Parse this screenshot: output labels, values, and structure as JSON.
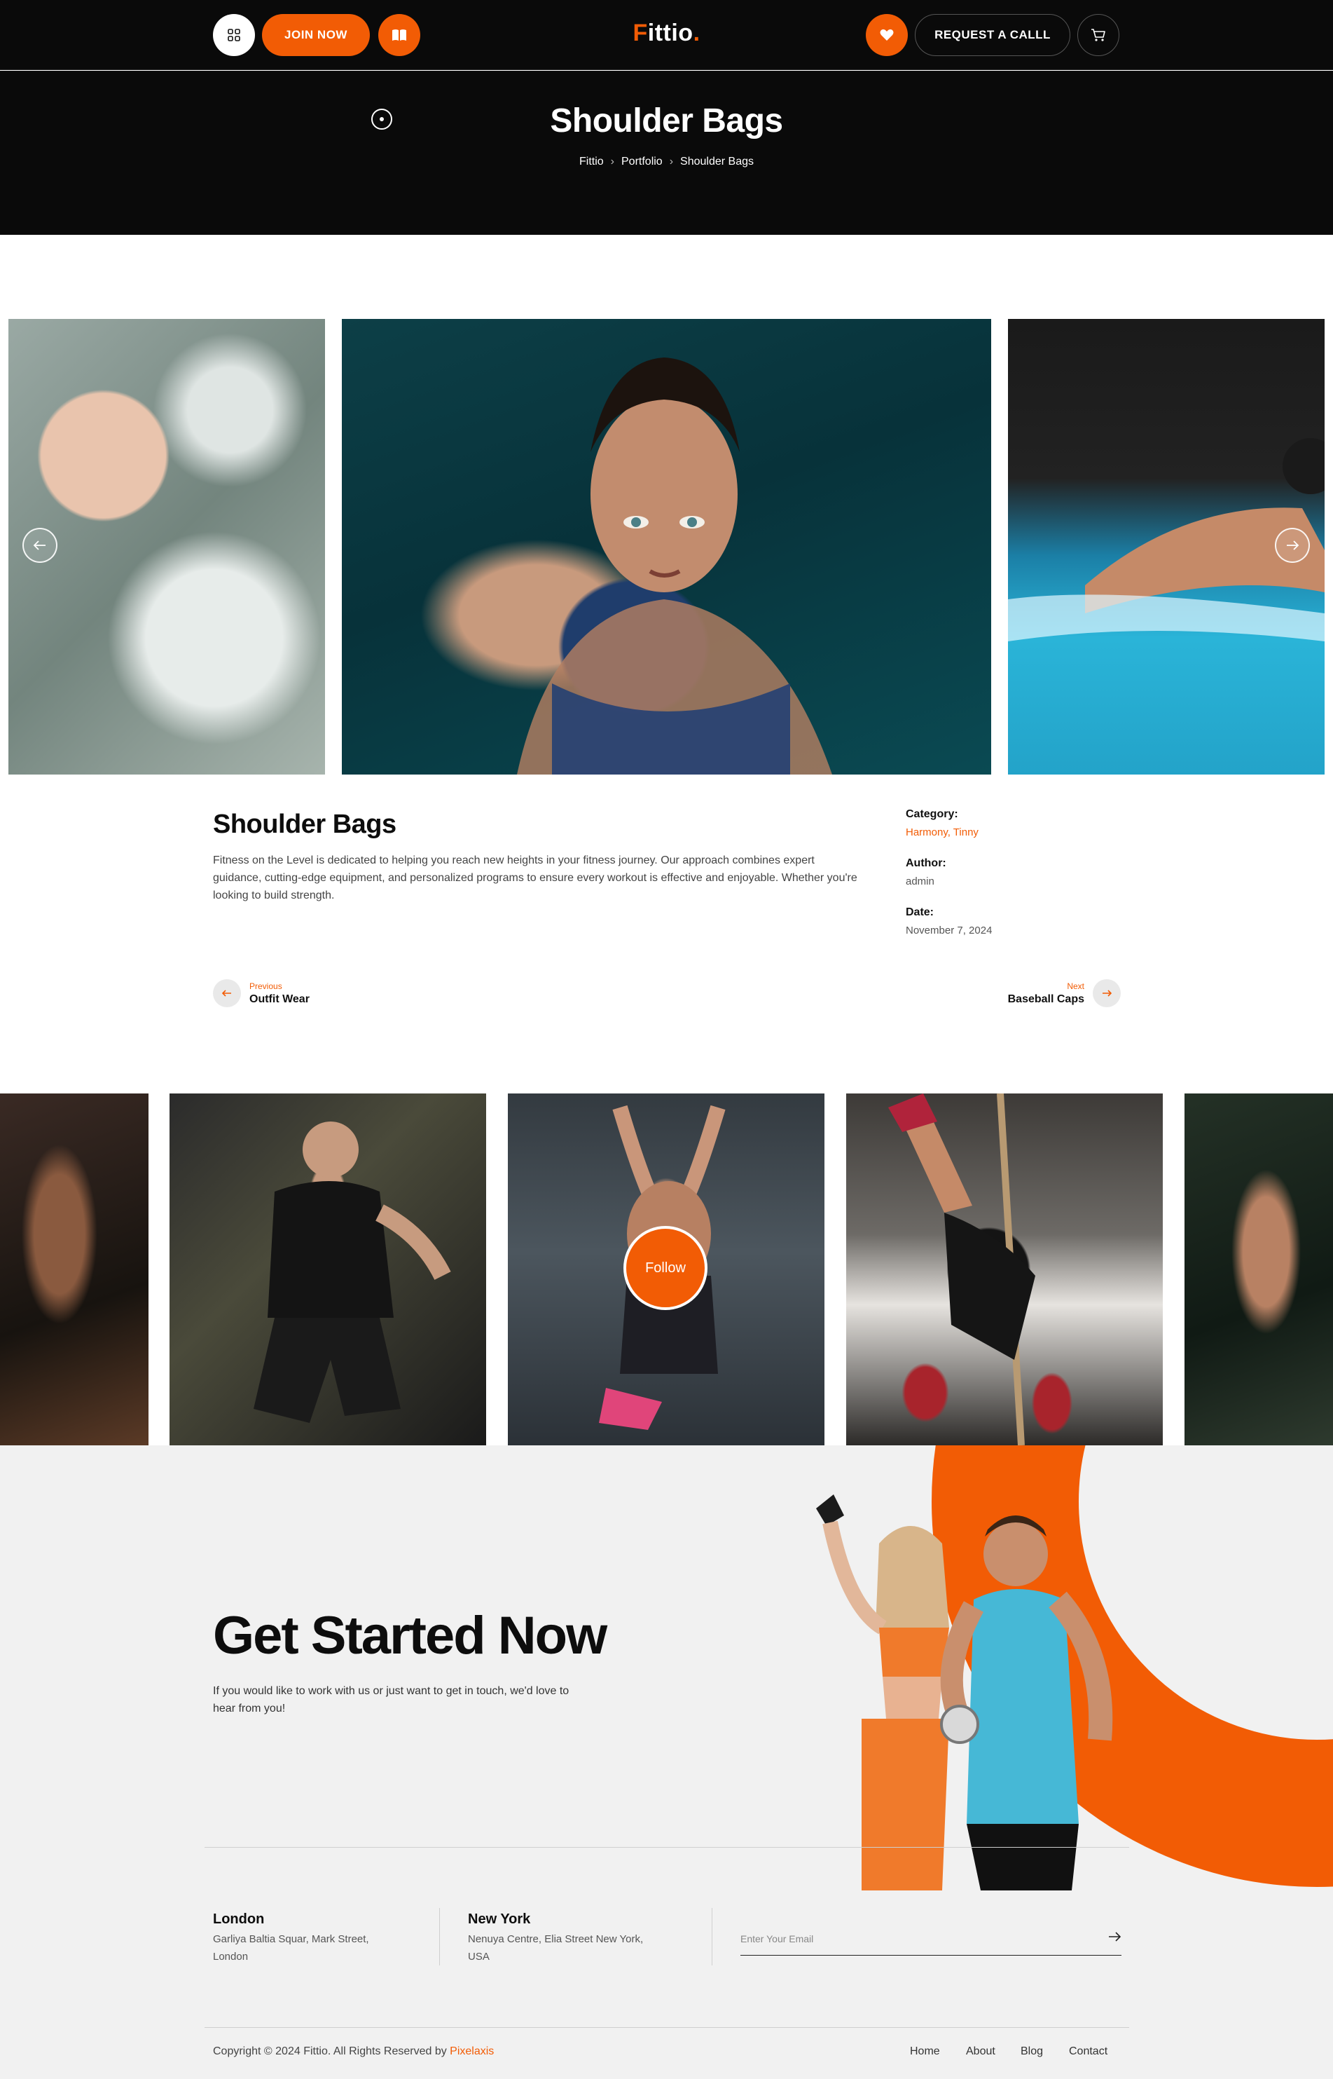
{
  "header": {
    "join_label": "JOIN NOW",
    "logo_letter": "F",
    "logo_rest": "ittio",
    "logo_dot": ".",
    "request_label": "REQUEST A CALLL",
    "icons": [
      "grid-icon",
      "book-icon",
      "heart-icon",
      "cart-icon"
    ],
    "accent_color": "#f25c05"
  },
  "hero": {
    "title": "Shoulder Bags",
    "breadcrumb": [
      "Fittio",
      "Portfolio",
      "Shoulder Bags"
    ],
    "separator": "›"
  },
  "project": {
    "title": "Shoulder Bags",
    "description": "Fitness on the Level is dedicated to helping you reach new heights in your fitness journey. Our approach combines expert guidance, cutting-edge equipment, and personalized programs to ensure every workout is effective and enjoyable. Whether you're looking to build strength.",
    "category_label": "Category:",
    "category_value": "Harmony, Tinny",
    "author_label": "Author:",
    "author_value": "admin",
    "date_label": "Date:",
    "date_value": "November 7, 2024"
  },
  "post_nav": {
    "prev_small": "Previous",
    "prev_title": "Outfit Wear",
    "next_small": "Next",
    "next_title": "Baseball Caps"
  },
  "instagram": {
    "follow_label": "Follow"
  },
  "cta": {
    "title": "Get Started Now",
    "text": "If you would like to work with us or just want to get in touch, we'd love to hear from you!"
  },
  "offices": [
    {
      "city": "London",
      "address": "Garliya Baltia Squar, Mark Street, London"
    },
    {
      "city": "New York",
      "address": "Nenuya Centre, Elia Street New York, USA"
    }
  ],
  "newsletter": {
    "placeholder": "Enter Your Email",
    "value": ""
  },
  "footer": {
    "copyright": "Copyright © 2024 Fittio. All Rights Reserved by ",
    "brand": "Pixelaxis",
    "links": [
      "Home",
      "About",
      "Blog",
      "Contact"
    ]
  }
}
